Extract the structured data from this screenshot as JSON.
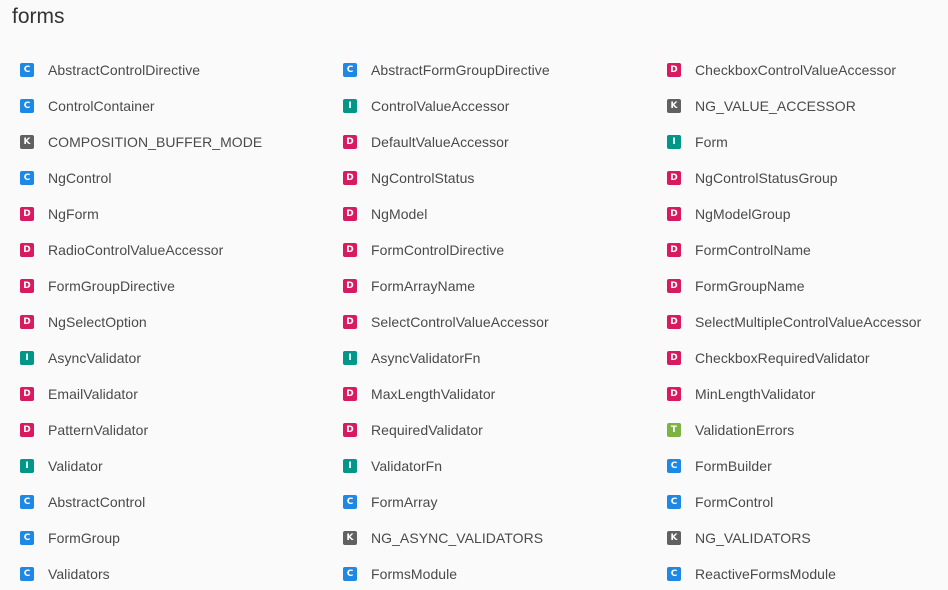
{
  "title": "forms",
  "badge_colors": {
    "C": "#1e88e5",
    "D": "#d81b60",
    "I": "#009688",
    "K": "#616161",
    "T": "#7cb342"
  },
  "items": [
    {
      "kind": "C",
      "name": "AbstractControlDirective"
    },
    {
      "kind": "C",
      "name": "AbstractFormGroupDirective"
    },
    {
      "kind": "D",
      "name": "CheckboxControlValueAccessor"
    },
    {
      "kind": "C",
      "name": "ControlContainer"
    },
    {
      "kind": "I",
      "name": "ControlValueAccessor"
    },
    {
      "kind": "K",
      "name": "NG_VALUE_ACCESSOR"
    },
    {
      "kind": "K",
      "name": "COMPOSITION_BUFFER_MODE"
    },
    {
      "kind": "D",
      "name": "DefaultValueAccessor"
    },
    {
      "kind": "I",
      "name": "Form"
    },
    {
      "kind": "C",
      "name": "NgControl"
    },
    {
      "kind": "D",
      "name": "NgControlStatus"
    },
    {
      "kind": "D",
      "name": "NgControlStatusGroup"
    },
    {
      "kind": "D",
      "name": "NgForm"
    },
    {
      "kind": "D",
      "name": "NgModel"
    },
    {
      "kind": "D",
      "name": "NgModelGroup"
    },
    {
      "kind": "D",
      "name": "RadioControlValueAccessor"
    },
    {
      "kind": "D",
      "name": "FormControlDirective"
    },
    {
      "kind": "D",
      "name": "FormControlName"
    },
    {
      "kind": "D",
      "name": "FormGroupDirective"
    },
    {
      "kind": "D",
      "name": "FormArrayName"
    },
    {
      "kind": "D",
      "name": "FormGroupName"
    },
    {
      "kind": "D",
      "name": "NgSelectOption"
    },
    {
      "kind": "D",
      "name": "SelectControlValueAccessor"
    },
    {
      "kind": "D",
      "name": "SelectMultipleControlValueAccessor"
    },
    {
      "kind": "I",
      "name": "AsyncValidator"
    },
    {
      "kind": "I",
      "name": "AsyncValidatorFn"
    },
    {
      "kind": "D",
      "name": "CheckboxRequiredValidator"
    },
    {
      "kind": "D",
      "name": "EmailValidator"
    },
    {
      "kind": "D",
      "name": "MaxLengthValidator"
    },
    {
      "kind": "D",
      "name": "MinLengthValidator"
    },
    {
      "kind": "D",
      "name": "PatternValidator"
    },
    {
      "kind": "D",
      "name": "RequiredValidator"
    },
    {
      "kind": "T",
      "name": "ValidationErrors"
    },
    {
      "kind": "I",
      "name": "Validator"
    },
    {
      "kind": "I",
      "name": "ValidatorFn"
    },
    {
      "kind": "C",
      "name": "FormBuilder"
    },
    {
      "kind": "C",
      "name": "AbstractControl"
    },
    {
      "kind": "C",
      "name": "FormArray"
    },
    {
      "kind": "C",
      "name": "FormControl"
    },
    {
      "kind": "C",
      "name": "FormGroup"
    },
    {
      "kind": "K",
      "name": "NG_ASYNC_VALIDATORS"
    },
    {
      "kind": "K",
      "name": "NG_VALIDATORS"
    },
    {
      "kind": "C",
      "name": "Validators"
    },
    {
      "kind": "C",
      "name": "FormsModule"
    },
    {
      "kind": "C",
      "name": "ReactiveFormsModule"
    }
  ]
}
